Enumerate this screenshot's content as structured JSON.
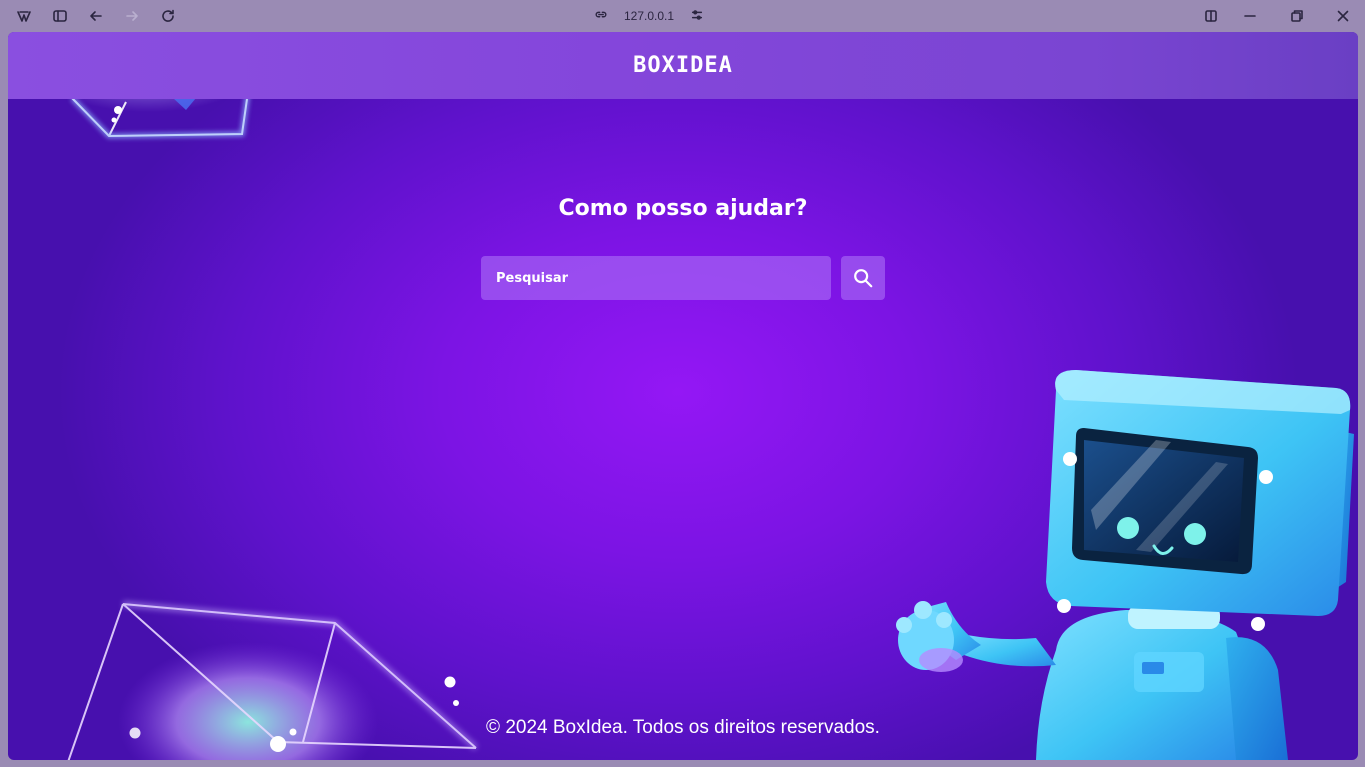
{
  "browser": {
    "address": "127.0.0.1",
    "icons": [
      "app-logo-icon",
      "sidebar-toggle-icon",
      "back-icon",
      "forward-icon",
      "reload-icon",
      "link-icon",
      "site-settings-icon",
      "split-view-icon",
      "minimize-icon",
      "restore-icon",
      "close-icon"
    ]
  },
  "header": {
    "logo": "BOXIDEA"
  },
  "main": {
    "title": "Como posso ajudar?",
    "search": {
      "placeholder": "Pesquisar",
      "value": ""
    }
  },
  "footer": {
    "text": "© 2024 BoxIdea. Todos os direitos reservados."
  },
  "colors": {
    "background": "#7c14e4",
    "header": "#8446db",
    "robot": "#3ec4f5",
    "accent": "#a86ef5"
  }
}
